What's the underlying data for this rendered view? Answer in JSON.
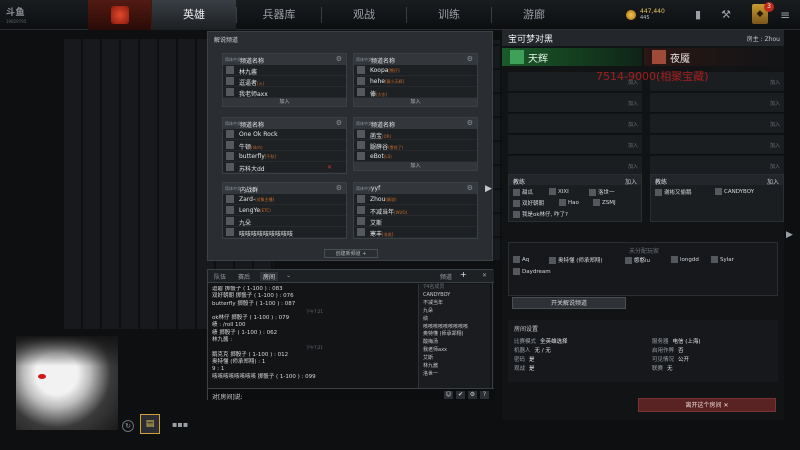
{
  "topbar": {
    "logo_main": "斗鱼",
    "logo_sub": "19829795",
    "tabs": [
      "英雄",
      "兵器库",
      "观战",
      "训练",
      "游廊"
    ],
    "active_tab": 0,
    "gold": "447,440",
    "gold_sub": "445"
  },
  "channels": {
    "title": "解说频道",
    "create_label": "创建新频道 +",
    "boxes": [
      {
        "lang": "简体中文",
        "name": "频道名称",
        "members": [
          {
            "name": "林九酱",
            "tag": ""
          },
          {
            "name": "逗逼者",
            "tag": "(火)"
          },
          {
            "name": "我老师axx",
            "tag": ""
          }
        ],
        "join": "加入"
      },
      {
        "lang": "简体中文",
        "name": "频道名称",
        "members": [
          {
            "name": "Koopa",
            "tag": "[熊仔]"
          },
          {
            "name": "hehe",
            "tag": "[黄小天辉]"
          },
          {
            "name": "傣",
            "tag": "(大东)"
          }
        ],
        "join": "加入"
      },
      {
        "lang": "简体中文",
        "name": "频道名称",
        "members": [
          {
            "name": "One Ok Rock",
            "tag": ""
          },
          {
            "name": "牛顿",
            "tag": "(ldch)"
          },
          {
            "name": "butterfly",
            "tag": "[千秋]"
          },
          {
            "name": "苏科大dd",
            "tag": ""
          }
        ],
        "join": ""
      },
      {
        "lang": "简体中文",
        "name": "频道名称",
        "members": [
          {
            "name": "菡宝",
            "tag": "(OR)"
          },
          {
            "name": "腿薛谷",
            "tag": "(零排了)"
          },
          {
            "name": "eBot",
            "tag": "(LS)"
          }
        ],
        "join": "加入"
      },
      {
        "lang": "简体中文",
        "name": "内战群",
        "members": [
          {
            "name": "Zard-",
            "tag": "(对象主播)"
          },
          {
            "name": "LengYe",
            "tag": "(ETC)"
          },
          {
            "name": "九朵",
            "tag": ""
          },
          {
            "name": "咳咳咳咳咳咳咳咳咳",
            "tag": ""
          }
        ],
        "join": ""
      },
      {
        "lang": "简体中文",
        "name": "yyf",
        "members": [
          {
            "name": "Zhou",
            "tag": "(解说)"
          },
          {
            "name": "不减当年",
            "tag": "(WUO)"
          },
          {
            "name": "艾斯",
            "tag": ""
          },
          {
            "name": "寒丰",
            "tag": "[非说]"
          }
        ],
        "join": ""
      }
    ]
  },
  "chat": {
    "tabs": [
      "队伍",
      "赛后",
      "房间"
    ],
    "channel_label": "频道",
    "input_placeholder": "对[房间]说:",
    "lines": [
      {
        "text": "逗碧 掷骰子 ( 1-100 ) : 083",
        "sys": false
      },
      {
        "text": "双好朝朝 掷骰子 ( 1-100 ) : 076",
        "sys": false
      },
      {
        "text": "butterfly 掷骰子 ( 1-100 ) : 087",
        "sys": false
      },
      {
        "text": "下午7:21",
        "sys": true
      },
      {
        "text": "ok林仔 掷骰子 ( 1-100 ) : 079",
        "sys": false
      },
      {
        "text": "绩 : /roll 100",
        "sys": false
      },
      {
        "text": "绩 掷骰子 ( 1-100 ) : 062",
        "sys": false
      },
      {
        "text": "林九酱 :",
        "sys": false
      },
      {
        "text": "下午7:21",
        "sys": true
      },
      {
        "text": "鹅克克 掷骰子 ( 1-100 ) : 012",
        "sys": false
      },
      {
        "text": "奥特懂 (师承郑翔) : 1",
        "sys": false
      },
      {
        "text": "9 : 1",
        "sys": false
      },
      {
        "text": "咳咳咳咳咳咳咳咳 掷骰子 ( 1-100 ) : 099",
        "sys": false
      }
    ],
    "members": [
      "74名成员",
      "CANDYBOY",
      "不减当年",
      "九朵",
      "绩",
      "咳咳咳咳咳咳咳咳咳",
      "奥特懂 (师承郑翔)",
      "酸梅汤",
      "我老师axx",
      "艾斯",
      "林九酱",
      "洛世一"
    ]
  },
  "lobby": {
    "name": "宝可梦对黑",
    "host": "房主 : Zhou",
    "radiant": "天辉",
    "dire": "夜魇",
    "watermark": "7514-9000(相聚宝藏)",
    "slot_label": "加入",
    "coach_title": "教练",
    "coach_join": "加入",
    "radiant_coaches": [
      "甜瓜",
      "XIXI",
      "洛世一",
      "双好朝朝",
      "Hao",
      "ZSMJ",
      "我是ok林仔, 咋了?"
    ],
    "dire_coaches": [
      "谢彬又偷鹅",
      "CANDYBOY"
    ],
    "unassigned_title": "未分配玩家",
    "unassigned": [
      "Aq",
      "奥特懂 (师承郑翔)",
      "憨憨iu",
      "longdd",
      "Sylar",
      "Daydream"
    ],
    "open_channel": "开关解说频道",
    "settings_title": "房间设置",
    "settings": [
      {
        "k": "比赛模式",
        "v": "全英雄选择"
      },
      {
        "k": "机器人",
        "v": "无 / 无"
      },
      {
        "k": "密码",
        "v": "是"
      },
      {
        "k": "观战",
        "v": "是"
      },
      {
        "k": "服务器",
        "v": "电信 (上海)"
      },
      {
        "k": "启用作弊",
        "v": "否"
      },
      {
        "k": "可见情况",
        "v": "公开"
      },
      {
        "k": "联赛",
        "v": "无"
      }
    ],
    "leave": "离开这个房间 ✕"
  }
}
